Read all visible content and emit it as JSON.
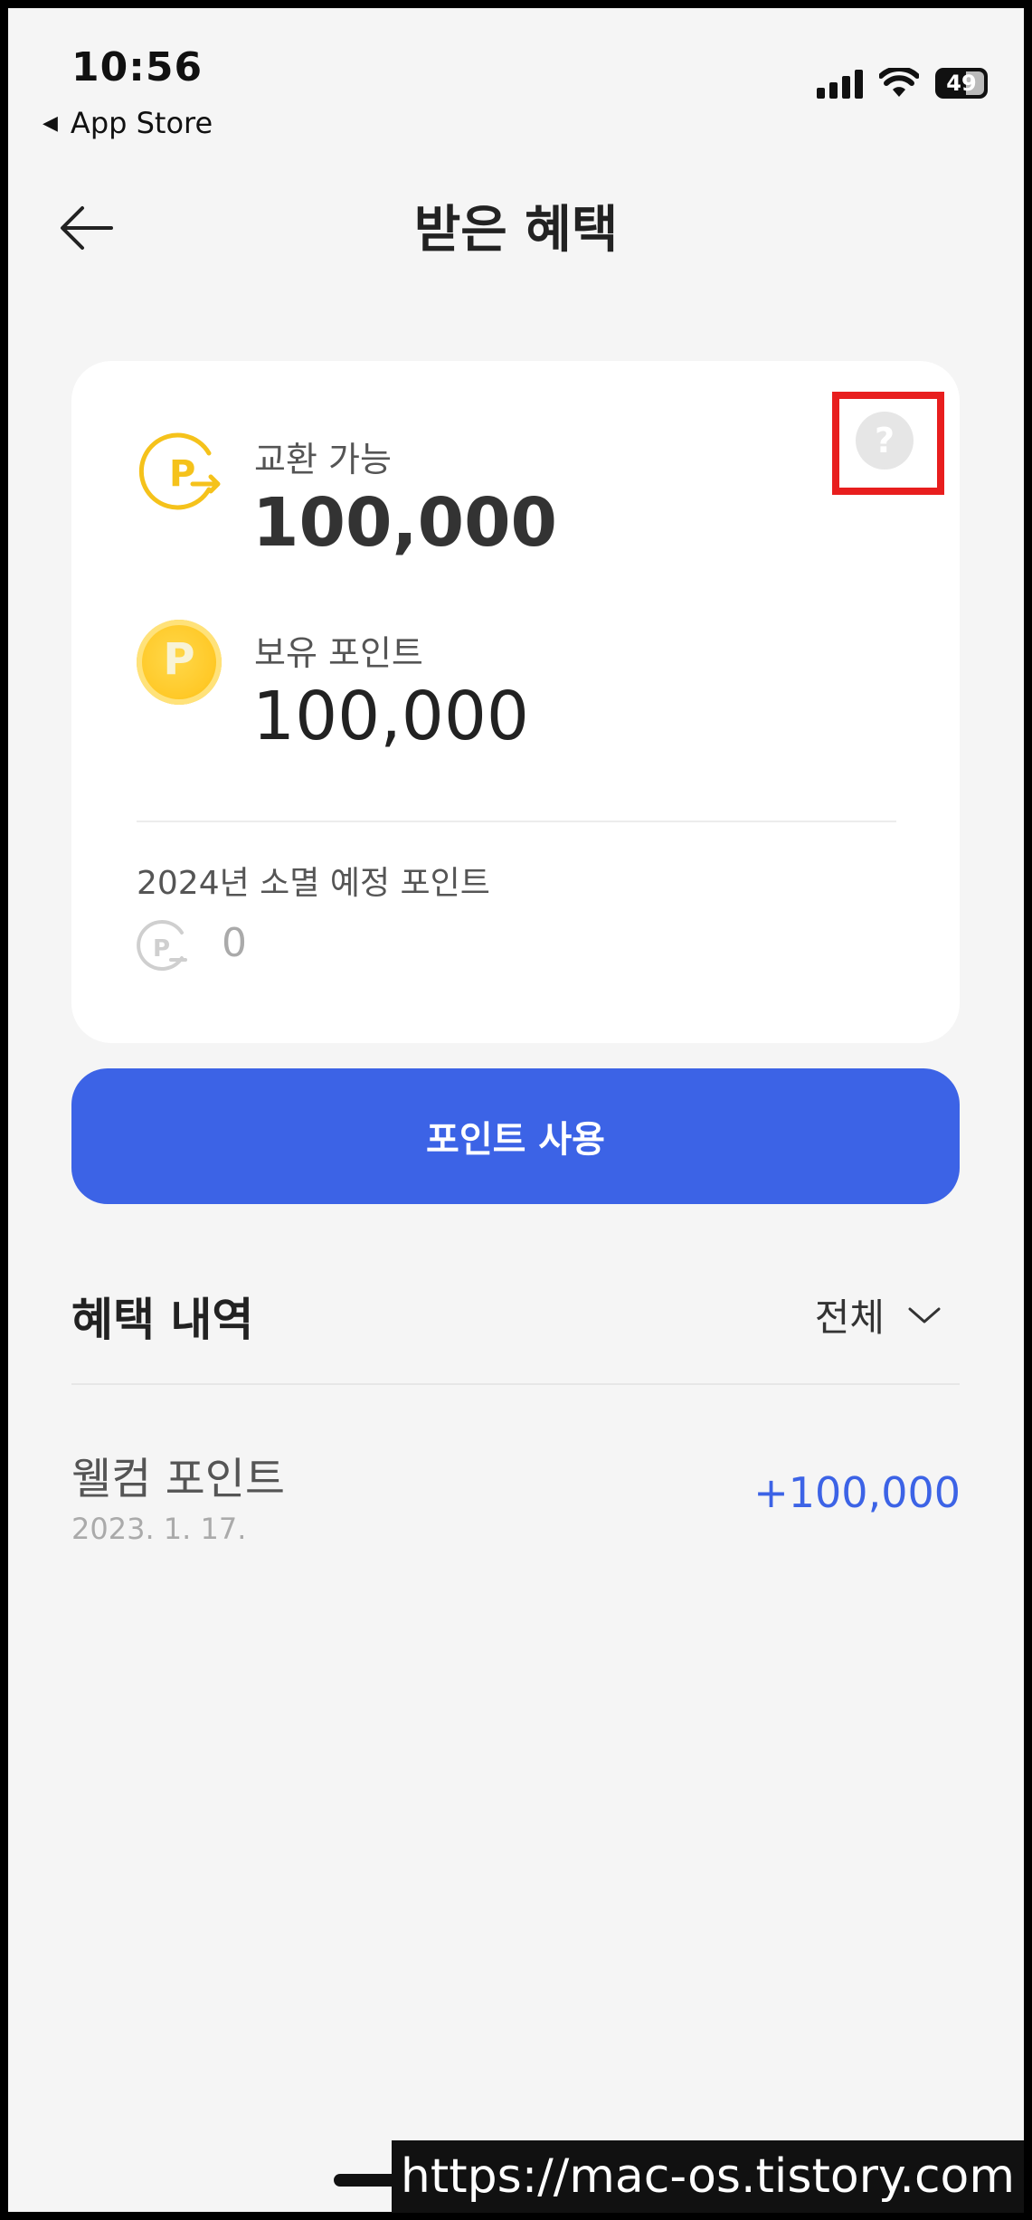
{
  "status_bar": {
    "time": "10:56",
    "back_app": "App Store",
    "battery": "49"
  },
  "header": {
    "title": "받은 혜택"
  },
  "summary": {
    "exchangeable_label": "교환 가능",
    "exchangeable_value": "100,000",
    "exchangeable_icon_letter": "P",
    "owned_label": "보유 포인트",
    "owned_value": "100,000",
    "owned_icon_letter": "P",
    "expire_label": "2024년 소멸 예정 포인트",
    "expire_value": "0",
    "help_glyph": "?"
  },
  "actions": {
    "use_points": "포인트 사용"
  },
  "history": {
    "title": "혜택 내역",
    "filter": "전체",
    "items": [
      {
        "name": "웰컴 포인트",
        "date": "2023. 1. 17.",
        "amount": "+100,000"
      }
    ]
  },
  "watermark": "https://mac-os.tistory.com",
  "colors": {
    "accent": "#3c63e6",
    "coin": "#ffc928",
    "highlight": "#e81e1e"
  }
}
